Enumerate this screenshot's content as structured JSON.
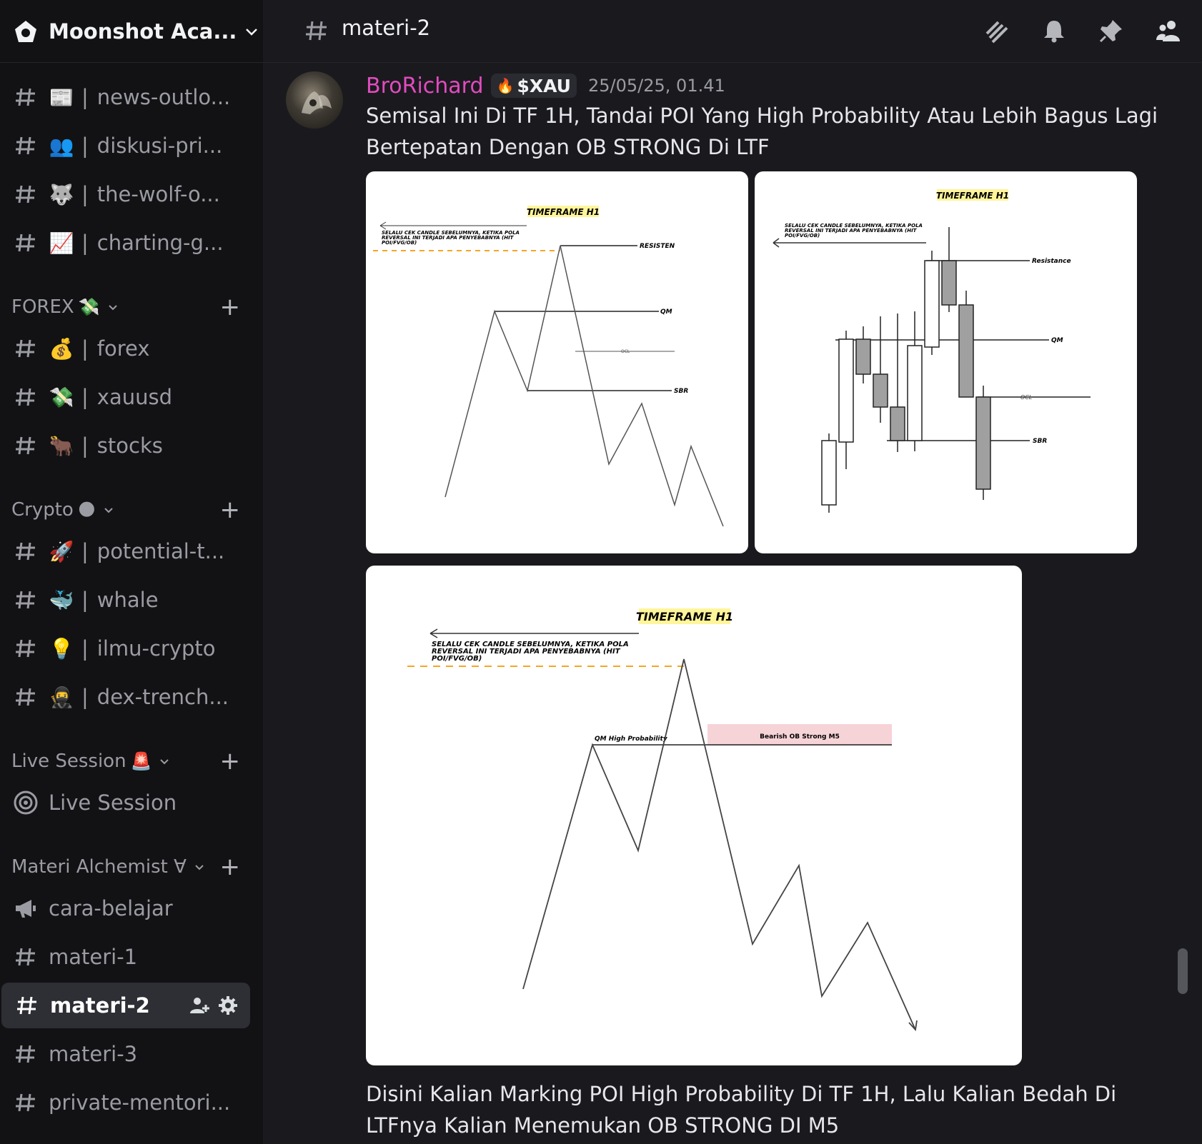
{
  "server": {
    "name": "Moonshot Aca..."
  },
  "sidebar": {
    "channels_top": [
      {
        "emoji": "📰",
        "name": "news-outlo..."
      },
      {
        "emoji": "👥",
        "name": "diskusi-pri..."
      },
      {
        "emoji": "🐺",
        "name": "the-wolf-o..."
      },
      {
        "emoji": "📈",
        "name": "charting-g..."
      }
    ],
    "categories": {
      "forex": {
        "label": "FOREX",
        "emoji": "💸"
      },
      "crypto": {
        "label": "Crypto",
        "emoji": "🌑"
      },
      "live": {
        "label": "Live Session",
        "emoji": "🚨"
      },
      "materi": {
        "label": "Materi Alchemist ∀"
      }
    },
    "forex_channels": [
      {
        "emoji": "💰",
        "name": "forex"
      },
      {
        "emoji": "💸",
        "name": "xauusd"
      },
      {
        "emoji": "🐂",
        "name": "stocks"
      }
    ],
    "crypto_channels": [
      {
        "emoji": "🚀",
        "name": "potential-t..."
      },
      {
        "emoji": "🐳",
        "name": "whale"
      },
      {
        "emoji": "💡",
        "name": "ilmu-crypto"
      },
      {
        "emoji": "🥷",
        "name": "dex-trench..."
      }
    ],
    "live_channels": [
      {
        "name": "Live Session"
      }
    ],
    "materi_channels": [
      {
        "name": "cara-belajar"
      },
      {
        "name": "materi-1"
      },
      {
        "name": "materi-2"
      },
      {
        "name": "materi-3"
      },
      {
        "name": "private-mentori..."
      }
    ],
    "separator": "|",
    "plus": "+"
  },
  "header": {
    "channel": "materi-2"
  },
  "message": {
    "author": "BroRichard",
    "author_color": "#e24bc0",
    "tag_icon": "🔥",
    "tag": "$XAU",
    "timestamp": "25/05/25, 01.41",
    "text_line1": "Semisal Ini Di TF 1H, Tandai POI Yang High Probability Atau Lebih Bagus Lagi",
    "text_line2": "Bertepatan Dengan OB STRONG Di LTF",
    "footer_line1": "Disini Kalian Marking POI High Probability Di TF 1H, Lalu Kalian Bedah Di",
    "footer_line2": "LTFnya Kalian Menemukan OB STRONG DI M5"
  },
  "images": {
    "img1": {
      "title": "TIMEFRAME H1",
      "note1": "SELALU CEK CANDLE SEBELUMNYA, KETIKA POLA",
      "note2": "REVERSAL INI TERJADI APA PENYEBABNYA (HIT",
      "note3": "POI/FVG/OB)",
      "resisten": "RESISTEN",
      "qm": "QM",
      "ocl": "OCL",
      "sbr": "SBR"
    },
    "img2": {
      "title": "TIMEFRAME H1",
      "note1": "SELALU CEK CANDLE SEBELUMNYA, KETIKA POLA",
      "note2": "REVERSAL INI TERJADI APA PENYEBABNYA (HIT",
      "note3": "POI/FVG/OB)",
      "resistance": "Resistance",
      "qm": "QM",
      "ocl": "OCL",
      "sbr": "SBR"
    },
    "img3": {
      "title": "TIMEFRAME H1",
      "note1": "SELALU CEK CANDLE SEBELUMNYA, KETIKA POLA",
      "note2": "REVERSAL INI TERJADI APA PENYEBABNYA (HIT",
      "note3": "POI/FVG/OB)",
      "qm": "QM High Probability",
      "ob": "Bearish OB Strong M5"
    }
  },
  "colors": {
    "accent_orange": "#f5a623",
    "highlight_yellow": "#fff59a",
    "ob_pink": "#f6d3d7"
  }
}
